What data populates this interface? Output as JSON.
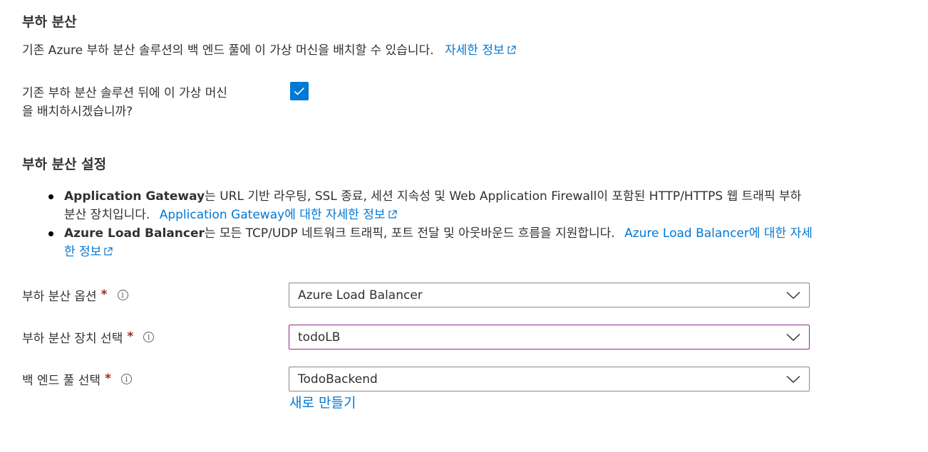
{
  "section1": {
    "title": "부하 분산",
    "description": "기존 Azure 부하 분산 솔루션의 백 엔드 풀에 이 가상 머신을 배치할 수 있습니다.",
    "learn_more": "자세한 정보"
  },
  "placement": {
    "label_line1": "기존 부하 분산 솔루션 뒤에 이 가상 머신",
    "label_line2": "을 배치하시겠습니까?",
    "checked": true
  },
  "section2": {
    "title": "부하 분산 설정",
    "bullets": [
      {
        "bold": "Application Gateway",
        "text": "는 URL 기반 라우팅, SSL 종료, 세션 지속성 및 Web Application Firewall이 포함된 HTTP/HTTPS 웹 트래픽 부하 분산 장치입니다.",
        "link_main": "Application Gateway",
        "link_suffix": "에 대한 자세한 정보"
      },
      {
        "bold": "Azure Load Balancer",
        "text": "는 모든 TCP/UDP 네트워크 트래픽, 포트 전달 및 아웃바운드 흐름을 지원합니다.",
        "link_main": "Azure Load Balancer",
        "link_suffix": "에 대한 자세한 정보"
      }
    ]
  },
  "fields": {
    "lb_option": {
      "label": "부하 분산 옵션",
      "value": "Azure Load Balancer"
    },
    "lb_select": {
      "label": "부하 분산 장치 선택",
      "value": "todoLB"
    },
    "backend_pool": {
      "label": "백 엔드 풀 선택",
      "value": "TodoBackend",
      "create_new": "새로 만들기"
    },
    "required_mark": "*",
    "info_glyph": "i"
  },
  "colors": {
    "accent": "#0078d4",
    "required": "#a4262c",
    "focus_border": "#8a2a8a"
  }
}
